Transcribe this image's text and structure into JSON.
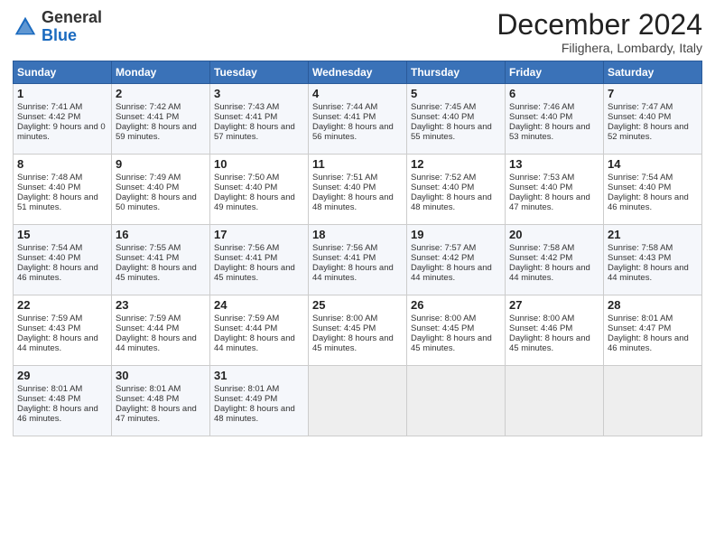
{
  "header": {
    "logo_general": "General",
    "logo_blue": "Blue",
    "month": "December 2024",
    "location": "Filighera, Lombardy, Italy"
  },
  "days_of_week": [
    "Sunday",
    "Monday",
    "Tuesday",
    "Wednesday",
    "Thursday",
    "Friday",
    "Saturday"
  ],
  "weeks": [
    [
      {
        "day": 1,
        "sunrise": "Sunrise: 7:41 AM",
        "sunset": "Sunset: 4:42 PM",
        "daylight": "Daylight: 9 hours and 0 minutes."
      },
      {
        "day": 2,
        "sunrise": "Sunrise: 7:42 AM",
        "sunset": "Sunset: 4:41 PM",
        "daylight": "Daylight: 8 hours and 59 minutes."
      },
      {
        "day": 3,
        "sunrise": "Sunrise: 7:43 AM",
        "sunset": "Sunset: 4:41 PM",
        "daylight": "Daylight: 8 hours and 57 minutes."
      },
      {
        "day": 4,
        "sunrise": "Sunrise: 7:44 AM",
        "sunset": "Sunset: 4:41 PM",
        "daylight": "Daylight: 8 hours and 56 minutes."
      },
      {
        "day": 5,
        "sunrise": "Sunrise: 7:45 AM",
        "sunset": "Sunset: 4:40 PM",
        "daylight": "Daylight: 8 hours and 55 minutes."
      },
      {
        "day": 6,
        "sunrise": "Sunrise: 7:46 AM",
        "sunset": "Sunset: 4:40 PM",
        "daylight": "Daylight: 8 hours and 53 minutes."
      },
      {
        "day": 7,
        "sunrise": "Sunrise: 7:47 AM",
        "sunset": "Sunset: 4:40 PM",
        "daylight": "Daylight: 8 hours and 52 minutes."
      }
    ],
    [
      {
        "day": 8,
        "sunrise": "Sunrise: 7:48 AM",
        "sunset": "Sunset: 4:40 PM",
        "daylight": "Daylight: 8 hours and 51 minutes."
      },
      {
        "day": 9,
        "sunrise": "Sunrise: 7:49 AM",
        "sunset": "Sunset: 4:40 PM",
        "daylight": "Daylight: 8 hours and 50 minutes."
      },
      {
        "day": 10,
        "sunrise": "Sunrise: 7:50 AM",
        "sunset": "Sunset: 4:40 PM",
        "daylight": "Daylight: 8 hours and 49 minutes."
      },
      {
        "day": 11,
        "sunrise": "Sunrise: 7:51 AM",
        "sunset": "Sunset: 4:40 PM",
        "daylight": "Daylight: 8 hours and 48 minutes."
      },
      {
        "day": 12,
        "sunrise": "Sunrise: 7:52 AM",
        "sunset": "Sunset: 4:40 PM",
        "daylight": "Daylight: 8 hours and 48 minutes."
      },
      {
        "day": 13,
        "sunrise": "Sunrise: 7:53 AM",
        "sunset": "Sunset: 4:40 PM",
        "daylight": "Daylight: 8 hours and 47 minutes."
      },
      {
        "day": 14,
        "sunrise": "Sunrise: 7:54 AM",
        "sunset": "Sunset: 4:40 PM",
        "daylight": "Daylight: 8 hours and 46 minutes."
      }
    ],
    [
      {
        "day": 15,
        "sunrise": "Sunrise: 7:54 AM",
        "sunset": "Sunset: 4:40 PM",
        "daylight": "Daylight: 8 hours and 46 minutes."
      },
      {
        "day": 16,
        "sunrise": "Sunrise: 7:55 AM",
        "sunset": "Sunset: 4:41 PM",
        "daylight": "Daylight: 8 hours and 45 minutes."
      },
      {
        "day": 17,
        "sunrise": "Sunrise: 7:56 AM",
        "sunset": "Sunset: 4:41 PM",
        "daylight": "Daylight: 8 hours and 45 minutes."
      },
      {
        "day": 18,
        "sunrise": "Sunrise: 7:56 AM",
        "sunset": "Sunset: 4:41 PM",
        "daylight": "Daylight: 8 hours and 44 minutes."
      },
      {
        "day": 19,
        "sunrise": "Sunrise: 7:57 AM",
        "sunset": "Sunset: 4:42 PM",
        "daylight": "Daylight: 8 hours and 44 minutes."
      },
      {
        "day": 20,
        "sunrise": "Sunrise: 7:58 AM",
        "sunset": "Sunset: 4:42 PM",
        "daylight": "Daylight: 8 hours and 44 minutes."
      },
      {
        "day": 21,
        "sunrise": "Sunrise: 7:58 AM",
        "sunset": "Sunset: 4:43 PM",
        "daylight": "Daylight: 8 hours and 44 minutes."
      }
    ],
    [
      {
        "day": 22,
        "sunrise": "Sunrise: 7:59 AM",
        "sunset": "Sunset: 4:43 PM",
        "daylight": "Daylight: 8 hours and 44 minutes."
      },
      {
        "day": 23,
        "sunrise": "Sunrise: 7:59 AM",
        "sunset": "Sunset: 4:44 PM",
        "daylight": "Daylight: 8 hours and 44 minutes."
      },
      {
        "day": 24,
        "sunrise": "Sunrise: 7:59 AM",
        "sunset": "Sunset: 4:44 PM",
        "daylight": "Daylight: 8 hours and 44 minutes."
      },
      {
        "day": 25,
        "sunrise": "Sunrise: 8:00 AM",
        "sunset": "Sunset: 4:45 PM",
        "daylight": "Daylight: 8 hours and 45 minutes."
      },
      {
        "day": 26,
        "sunrise": "Sunrise: 8:00 AM",
        "sunset": "Sunset: 4:45 PM",
        "daylight": "Daylight: 8 hours and 45 minutes."
      },
      {
        "day": 27,
        "sunrise": "Sunrise: 8:00 AM",
        "sunset": "Sunset: 4:46 PM",
        "daylight": "Daylight: 8 hours and 45 minutes."
      },
      {
        "day": 28,
        "sunrise": "Sunrise: 8:01 AM",
        "sunset": "Sunset: 4:47 PM",
        "daylight": "Daylight: 8 hours and 46 minutes."
      }
    ],
    [
      {
        "day": 29,
        "sunrise": "Sunrise: 8:01 AM",
        "sunset": "Sunset: 4:48 PM",
        "daylight": "Daylight: 8 hours and 46 minutes."
      },
      {
        "day": 30,
        "sunrise": "Sunrise: 8:01 AM",
        "sunset": "Sunset: 4:48 PM",
        "daylight": "Daylight: 8 hours and 47 minutes."
      },
      {
        "day": 31,
        "sunrise": "Sunrise: 8:01 AM",
        "sunset": "Sunset: 4:49 PM",
        "daylight": "Daylight: 8 hours and 48 minutes."
      },
      null,
      null,
      null,
      null
    ]
  ]
}
